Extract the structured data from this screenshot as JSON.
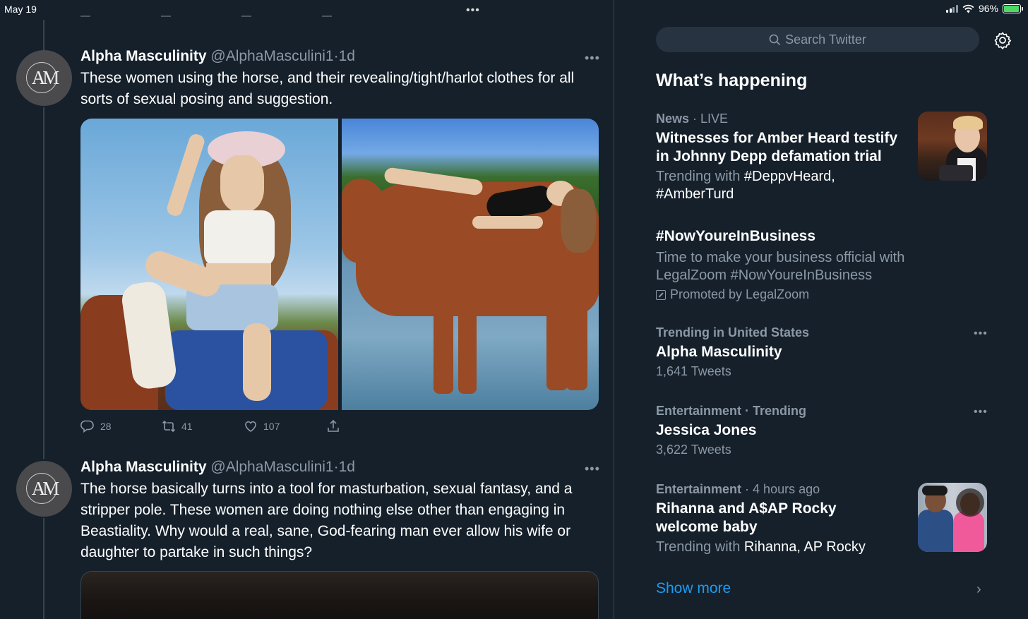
{
  "status_bar": {
    "time": "May 19",
    "battery": "96%",
    "battery_level": 0.96,
    "multitask_dots": "•••"
  },
  "tweets": [
    {
      "author_name": "Alpha Masculinity",
      "handle": "@AlphaMasculini1",
      "separator": "·",
      "age": "1d",
      "avatar_monogram": "AM",
      "text": "These women using the horse, and their revealing/tight/harlot clothes for all sorts of sexual posing and suggestion.",
      "more": "•••",
      "actions": {
        "replies": "28",
        "retweets": "41",
        "likes": "107"
      }
    },
    {
      "author_name": "Alpha Masculinity",
      "handle": "@AlphaMasculini1",
      "separator": "·",
      "age": "1d",
      "avatar_monogram": "AM",
      "text": "The horse basically turns into a tool for masturbation, sexual fantasy, and a stripper pole. These women are doing nothing else other than engaging in Beastiality. Why would a real, sane, God-fearing man ever allow his wife or daughter to partake in such things?",
      "more": "•••"
    }
  ],
  "sidebar": {
    "search_placeholder": "Search Twitter",
    "title": "What’s happening",
    "trends": [
      {
        "category": "News",
        "sub": "· LIVE",
        "headline": "Witnesses for Amber Heard testify in Johnny Depp defamation trial",
        "trending_with_prefix": "Trending with",
        "trending_with": "#DeppvHeard, #AmberTurd"
      },
      {
        "headline": "#NowYoureInBusiness",
        "description": "Time to make your business official with LegalZoom #NowYoureInBusiness",
        "promoted": "Promoted by LegalZoom"
      },
      {
        "category": "Trending in United States",
        "headline": "Alpha Masculinity",
        "count": "1,641 Tweets",
        "more": "•••"
      },
      {
        "category": "Entertainment · Trending",
        "headline": "Jessica Jones",
        "count": "3,622 Tweets",
        "more": "•••"
      },
      {
        "category": "Entertainment",
        "sub": "· 4 hours ago",
        "headline": "Rihanna and A$AP Rocky welcome baby",
        "trending_with_prefix": "Trending with",
        "trending_with": "Rihanna, AP Rocky"
      }
    ],
    "show_more": "Show more",
    "chevron": "›"
  },
  "colors": {
    "background": "#15202b",
    "accent": "#1d9bf0",
    "secondary_text": "#8b98a5",
    "border": "#38444d",
    "battery_green": "#4cd964"
  },
  "icons": [
    "reply-icon",
    "retweet-icon",
    "like-icon",
    "share-icon",
    "search-icon",
    "gear-icon",
    "promoted-icon",
    "chevron-right-icon"
  ]
}
